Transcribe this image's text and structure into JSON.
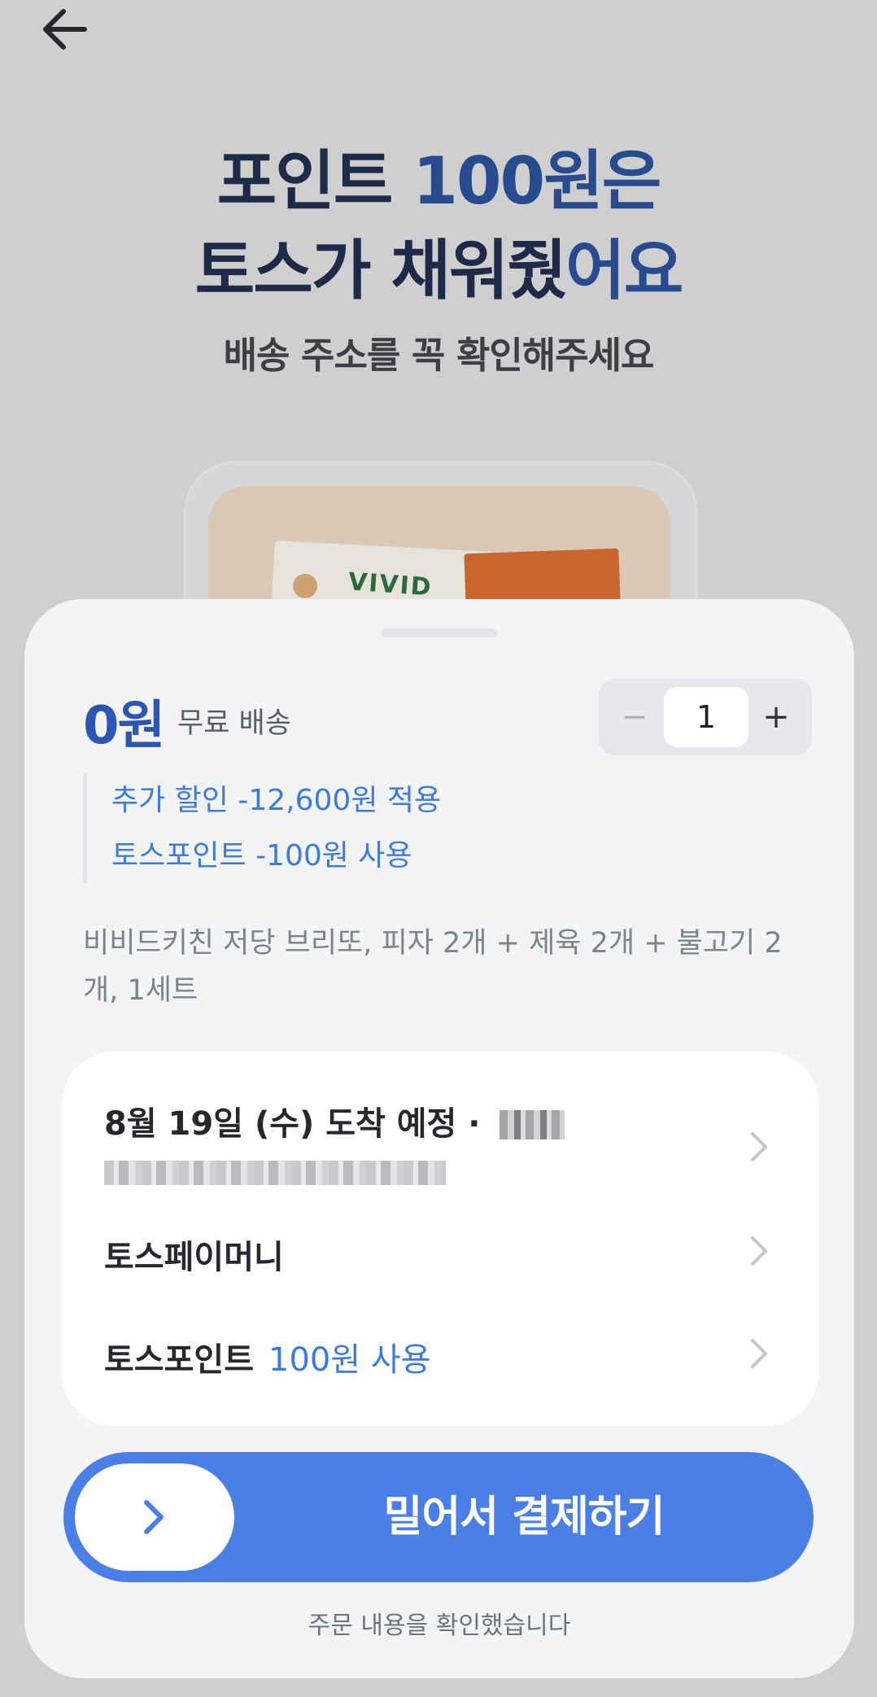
{
  "header": {
    "headline_prefix": "포인트 ",
    "headline_accent": "100원은",
    "headline_line2_prefix": "토스가 채워줬",
    "headline_line2_accent": "어요",
    "subtitle": "배송 주소를 꼭 확인해주세요"
  },
  "product_preview": {
    "package_text": "VIVID"
  },
  "sheet": {
    "price": "0원",
    "shipping_label": "무료 배송",
    "quantity": "1",
    "minus_symbol": "−",
    "plus_symbol": "+",
    "discounts": [
      {
        "label": "추가 할인 -12,600원 적용"
      },
      {
        "label": "토스포인트 -100원 사용"
      }
    ],
    "product_title": "비비드키친 저당 브리또, 피자 2개 + 제육 2개 + 불고기 2개, 1세트",
    "info_rows": {
      "delivery_label": "8월 19일 (수) 도착 예정 ·",
      "payment_method": "토스페이머니",
      "points_label": "토스포인트",
      "points_value": "100원 사용"
    },
    "swipe_label": "밀어서 결제하기",
    "confirm_note": "주문 내용을 확인했습니다"
  },
  "colors": {
    "accent_blue": "#4a7fe8",
    "link_blue": "#3d7ae0",
    "price_blue": "#2d55b5",
    "headline_navy": "#1d2a48"
  },
  "icons": {
    "back": "arrow-left-icon",
    "chevron": "chevron-right-icon",
    "swipe": "chevron-right-icon"
  }
}
